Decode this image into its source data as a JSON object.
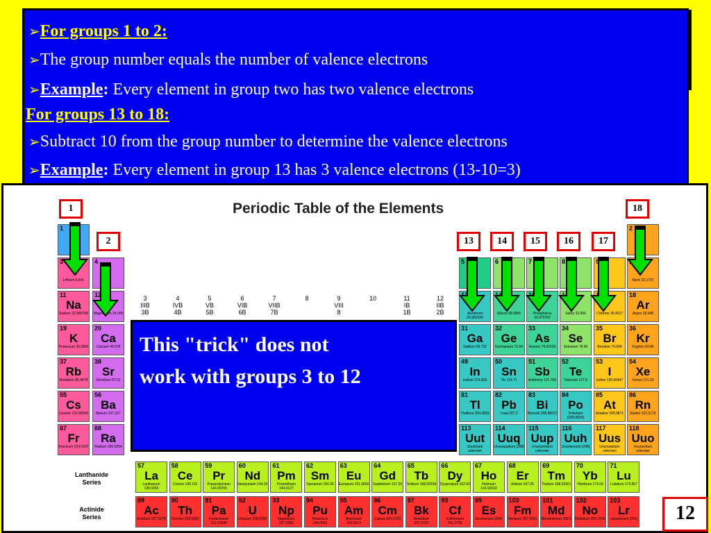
{
  "rules": {
    "line1": "For groups 1 to 2:",
    "line2": "The group number equals the number of valence electrons",
    "line3_label": "Example",
    "line3_text": " Every element in group two has two valence electrons",
    "line4": "For groups 13 to 18:",
    "line5": "Subtract 10 from the group number to determine the valence electrons",
    "line6_label": "Example",
    "line6_text": "  Every element in group 13 has 3 valence electrons (13-10=3)",
    "bullet": "➢",
    "colon": ":"
  },
  "table": {
    "title": "Periodic Table of the Elements",
    "lanthanide_label_1": "Lanthanide",
    "lanthanide_label_2": "Series",
    "actinide_label_1": "Actinide",
    "actinide_label_2": "Series",
    "group_markers": [
      "1",
      "2",
      "13",
      "14",
      "15",
      "16",
      "17",
      "18"
    ],
    "transition_headers": [
      {
        "n": "3",
        "r": "IIIB",
        "s": "3B"
      },
      {
        "n": "4",
        "r": "IVB",
        "s": "4B"
      },
      {
        "n": "5",
        "r": "VB",
        "s": "5B"
      },
      {
        "n": "6",
        "r": "VIB",
        "s": "6B"
      },
      {
        "n": "7",
        "r": "VIIB",
        "s": "7B"
      },
      {
        "n": "8",
        "r": "",
        "s": ""
      },
      {
        "n": "9",
        "r": "VIII",
        "s": "8"
      },
      {
        "n": "10",
        "r": "",
        "s": ""
      },
      {
        "n": "11",
        "r": "IB",
        "s": "1B"
      },
      {
        "n": "12",
        "r": "IIB",
        "s": "2B"
      }
    ],
    "elements_left": [
      {
        "num": "3",
        "sym": "",
        "name": "Lithium",
        "mass": "6.941",
        "row": 1,
        "col": 0
      },
      {
        "num": "11",
        "sym": "Na",
        "name": "Sodium",
        "mass": "22.989768",
        "row": 2,
        "col": 0
      },
      {
        "num": "19",
        "sym": "K",
        "name": "Potassium",
        "mass": "39.0983",
        "row": 3,
        "col": 0
      },
      {
        "num": "37",
        "sym": "Rb",
        "name": "Rubidium",
        "mass": "85.4678",
        "row": 4,
        "col": 0
      },
      {
        "num": "55",
        "sym": "Cs",
        "name": "Cesium",
        "mass": "132.90543",
        "row": 5,
        "col": 0
      },
      {
        "num": "87",
        "sym": "Fr",
        "name": "Francium",
        "mass": "223.0197",
        "row": 6,
        "col": 0
      },
      {
        "num": "1",
        "sym": "",
        "name": "",
        "mass": "",
        "row": 0,
        "col": 0
      },
      {
        "num": "4",
        "sym": "",
        "name": "",
        "mass": "",
        "row": 1,
        "col": 1
      },
      {
        "num": "12",
        "sym": "",
        "name": "Magnesium",
        "mass": "24.305",
        "row": 2,
        "col": 1
      },
      {
        "num": "20",
        "sym": "Ca",
        "name": "Calcium",
        "mass": "40.078",
        "row": 3,
        "col": 1
      },
      {
        "num": "38",
        "sym": "Sr",
        "name": "Strontium",
        "mass": "87.62",
        "row": 4,
        "col": 1
      },
      {
        "num": "56",
        "sym": "Ba",
        "name": "Barium",
        "mass": "137.327",
        "row": 5,
        "col": 1
      },
      {
        "num": "88",
        "sym": "Ra",
        "name": "Radium",
        "mass": "226.0254",
        "row": 6,
        "col": 1
      }
    ],
    "elements_right": [
      {
        "num": "2",
        "sym": "",
        "name": "",
        "mass": "",
        "row": 0,
        "col": 17
      },
      {
        "num": "5",
        "sym": "",
        "name": "",
        "mass": "",
        "row": 1,
        "col": 12
      },
      {
        "num": "6",
        "sym": "",
        "name": "",
        "mass": "",
        "row": 1,
        "col": 13
      },
      {
        "num": "7",
        "sym": "",
        "name": "",
        "mass": "",
        "row": 1,
        "col": 14
      },
      {
        "num": "8",
        "sym": "",
        "name": "",
        "mass": "",
        "row": 1,
        "col": 15
      },
      {
        "num": "9",
        "sym": "",
        "name": "",
        "mass": "",
        "row": 1,
        "col": 16
      },
      {
        "num": "10",
        "sym": "",
        "name": "Neon",
        "mass": "20.1797",
        "row": 1,
        "col": 17
      },
      {
        "num": "13",
        "sym": "",
        "name": "Aluminum",
        "mass": "26.981539",
        "row": 2,
        "col": 12
      },
      {
        "num": "14",
        "sym": "",
        "name": "Silicon",
        "mass": "28.0855",
        "row": 2,
        "col": 13
      },
      {
        "num": "15",
        "sym": "",
        "name": "Phosphorus",
        "mass": "30.973762",
        "row": 2,
        "col": 14
      },
      {
        "num": "16",
        "sym": "",
        "name": "Sulfur",
        "mass": "32.066",
        "row": 2,
        "col": 15
      },
      {
        "num": "17",
        "sym": "",
        "name": "Chlorine",
        "mass": "35.4527",
        "row": 2,
        "col": 16
      },
      {
        "num": "18",
        "sym": "Ar",
        "name": "Argon",
        "mass": "39.948",
        "row": 2,
        "col": 17
      },
      {
        "num": "31",
        "sym": "Ga",
        "name": "Gallium",
        "mass": "69.732",
        "row": 3,
        "col": 12
      },
      {
        "num": "32",
        "sym": "Ge",
        "name": "Germanium",
        "mass": "72.64",
        "row": 3,
        "col": 13
      },
      {
        "num": "33",
        "sym": "As",
        "name": "Arsenic",
        "mass": "74.92159",
        "row": 3,
        "col": 14
      },
      {
        "num": "34",
        "sym": "Se",
        "name": "Selenium",
        "mass": "78.96",
        "row": 3,
        "col": 15
      },
      {
        "num": "35",
        "sym": "Br",
        "name": "Bromine",
        "mass": "79.904",
        "row": 3,
        "col": 16
      },
      {
        "num": "36",
        "sym": "Kr",
        "name": "Krypton",
        "mass": "83.80",
        "row": 3,
        "col": 17
      },
      {
        "num": "49",
        "sym": "In",
        "name": "Indium",
        "mass": "114.818",
        "row": 4,
        "col": 12
      },
      {
        "num": "50",
        "sym": "Sn",
        "name": "Tin",
        "mass": "118.71",
        "row": 4,
        "col": 13
      },
      {
        "num": "51",
        "sym": "Sb",
        "name": "Antimony",
        "mass": "121.760",
        "row": 4,
        "col": 14
      },
      {
        "num": "52",
        "sym": "Te",
        "name": "Tellurium",
        "mass": "127.6",
        "row": 4,
        "col": 15
      },
      {
        "num": "53",
        "sym": "I",
        "name": "Iodine",
        "mass": "126.90447",
        "row": 4,
        "col": 16
      },
      {
        "num": "54",
        "sym": "Xe",
        "name": "Xenon",
        "mass": "131.29",
        "row": 4,
        "col": 17
      },
      {
        "num": "81",
        "sym": "Tl",
        "name": "Thallium",
        "mass": "204.3833",
        "row": 5,
        "col": 12
      },
      {
        "num": "82",
        "sym": "Pb",
        "name": "Lead",
        "mass": "207.2",
        "row": 5,
        "col": 13
      },
      {
        "num": "83",
        "sym": "Bi",
        "name": "Bismuth",
        "mass": "208.98037",
        "row": 5,
        "col": 14
      },
      {
        "num": "84",
        "sym": "Po",
        "name": "Polonium",
        "mass": "[208.9824]",
        "row": 5,
        "col": 15
      },
      {
        "num": "85",
        "sym": "At",
        "name": "Astatine",
        "mass": "209.9871",
        "row": 5,
        "col": 16
      },
      {
        "num": "86",
        "sym": "Rn",
        "name": "Radon",
        "mass": "222.0176",
        "row": 5,
        "col": 17
      },
      {
        "num": "113",
        "sym": "Uut",
        "name": "Ununtrium",
        "mass": "unknown",
        "row": 6,
        "col": 12
      },
      {
        "num": "114",
        "sym": "Uuq",
        "name": "Ununquadium",
        "mass": "[289]",
        "row": 6,
        "col": 13
      },
      {
        "num": "115",
        "sym": "Uup",
        "name": "Ununpentium",
        "mass": "unknown",
        "row": 6,
        "col": 14
      },
      {
        "num": "116",
        "sym": "Uuh",
        "name": "Ununhexium",
        "mass": "[298]",
        "row": 6,
        "col": 15
      },
      {
        "num": "117",
        "sym": "Uus",
        "name": "Ununseptium",
        "mass": "unknown",
        "row": 6,
        "col": 16
      },
      {
        "num": "118",
        "sym": "Uuo",
        "name": "Ununoctium",
        "mass": "unknown",
        "row": 6,
        "col": 17
      }
    ],
    "lanthanides": [
      {
        "num": "57",
        "sym": "La",
        "name": "Lanthanum",
        "mass": "138.9055"
      },
      {
        "num": "58",
        "sym": "Ce",
        "name": "Cerium",
        "mass": "140.115"
      },
      {
        "num": "59",
        "sym": "Pr",
        "name": "Praseodymium",
        "mass": "140.90765"
      },
      {
        "num": "60",
        "sym": "Nd",
        "name": "Neodymium",
        "mass": "144.24"
      },
      {
        "num": "61",
        "sym": "Pm",
        "name": "Promethium",
        "mass": "144.9127"
      },
      {
        "num": "62",
        "sym": "Sm",
        "name": "Samarium",
        "mass": "150.36"
      },
      {
        "num": "63",
        "sym": "Eu",
        "name": "Europium",
        "mass": "151.9655"
      },
      {
        "num": "64",
        "sym": "Gd",
        "name": "Gadolinium",
        "mass": "157.25"
      },
      {
        "num": "65",
        "sym": "Tb",
        "name": "Terbium",
        "mass": "158.92534"
      },
      {
        "num": "66",
        "sym": "Dy",
        "name": "Dysprosium",
        "mass": "162.50"
      },
      {
        "num": "67",
        "sym": "Ho",
        "name": "Holmium",
        "mass": "164.93032"
      },
      {
        "num": "68",
        "sym": "Er",
        "name": "Erbium",
        "mass": "167.26"
      },
      {
        "num": "69",
        "sym": "Tm",
        "name": "Thulium",
        "mass": "168.93421"
      },
      {
        "num": "70",
        "sym": "Yb",
        "name": "Ytterbium",
        "mass": "173.04"
      },
      {
        "num": "71",
        "sym": "Lu",
        "name": "Lutetium",
        "mass": "174.967"
      }
    ],
    "actinides": [
      {
        "num": "89",
        "sym": "Ac",
        "name": "Actinium",
        "mass": "227.0278"
      },
      {
        "num": "90",
        "sym": "Th",
        "name": "Thorium",
        "mass": "232.0381"
      },
      {
        "num": "91",
        "sym": "Pa",
        "name": "Protactinium",
        "mass": "231.03588"
      },
      {
        "num": "92",
        "sym": "U",
        "name": "Uranium",
        "mass": "238.0289"
      },
      {
        "num": "93",
        "sym": "Np",
        "name": "Neptunium",
        "mass": "237.0482"
      },
      {
        "num": "94",
        "sym": "Pu",
        "name": "Plutonium",
        "mass": "244.0642"
      },
      {
        "num": "95",
        "sym": "Am",
        "name": "Americium",
        "mass": "243.0614"
      },
      {
        "num": "96",
        "sym": "Cm",
        "name": "Curium",
        "mass": "247.0703"
      },
      {
        "num": "97",
        "sym": "Bk",
        "name": "Berkelium",
        "mass": "247.0703"
      },
      {
        "num": "98",
        "sym": "Cf",
        "name": "Californium",
        "mass": "251.0796"
      },
      {
        "num": "99",
        "sym": "Es",
        "name": "Einsteinium",
        "mass": "[254]"
      },
      {
        "num": "100",
        "sym": "Fm",
        "name": "Fermium",
        "mass": "257.0951"
      },
      {
        "num": "101",
        "sym": "Md",
        "name": "Mendelevium",
        "mass": "258.1"
      },
      {
        "num": "102",
        "sym": "No",
        "name": "Nobelium",
        "mass": "259.1009"
      },
      {
        "num": "103",
        "sym": "Lr",
        "name": "Lawrencium",
        "mass": "[262]"
      }
    ]
  },
  "callout": {
    "line1": "This  \"trick\" does not",
    "line2": "work with groups 3 to 12"
  },
  "page_number": "12",
  "colors": {
    "background": "#ffff00",
    "box_blue": "#0000f0",
    "label_red": "#e00000",
    "arrow_green": "#00e000"
  }
}
